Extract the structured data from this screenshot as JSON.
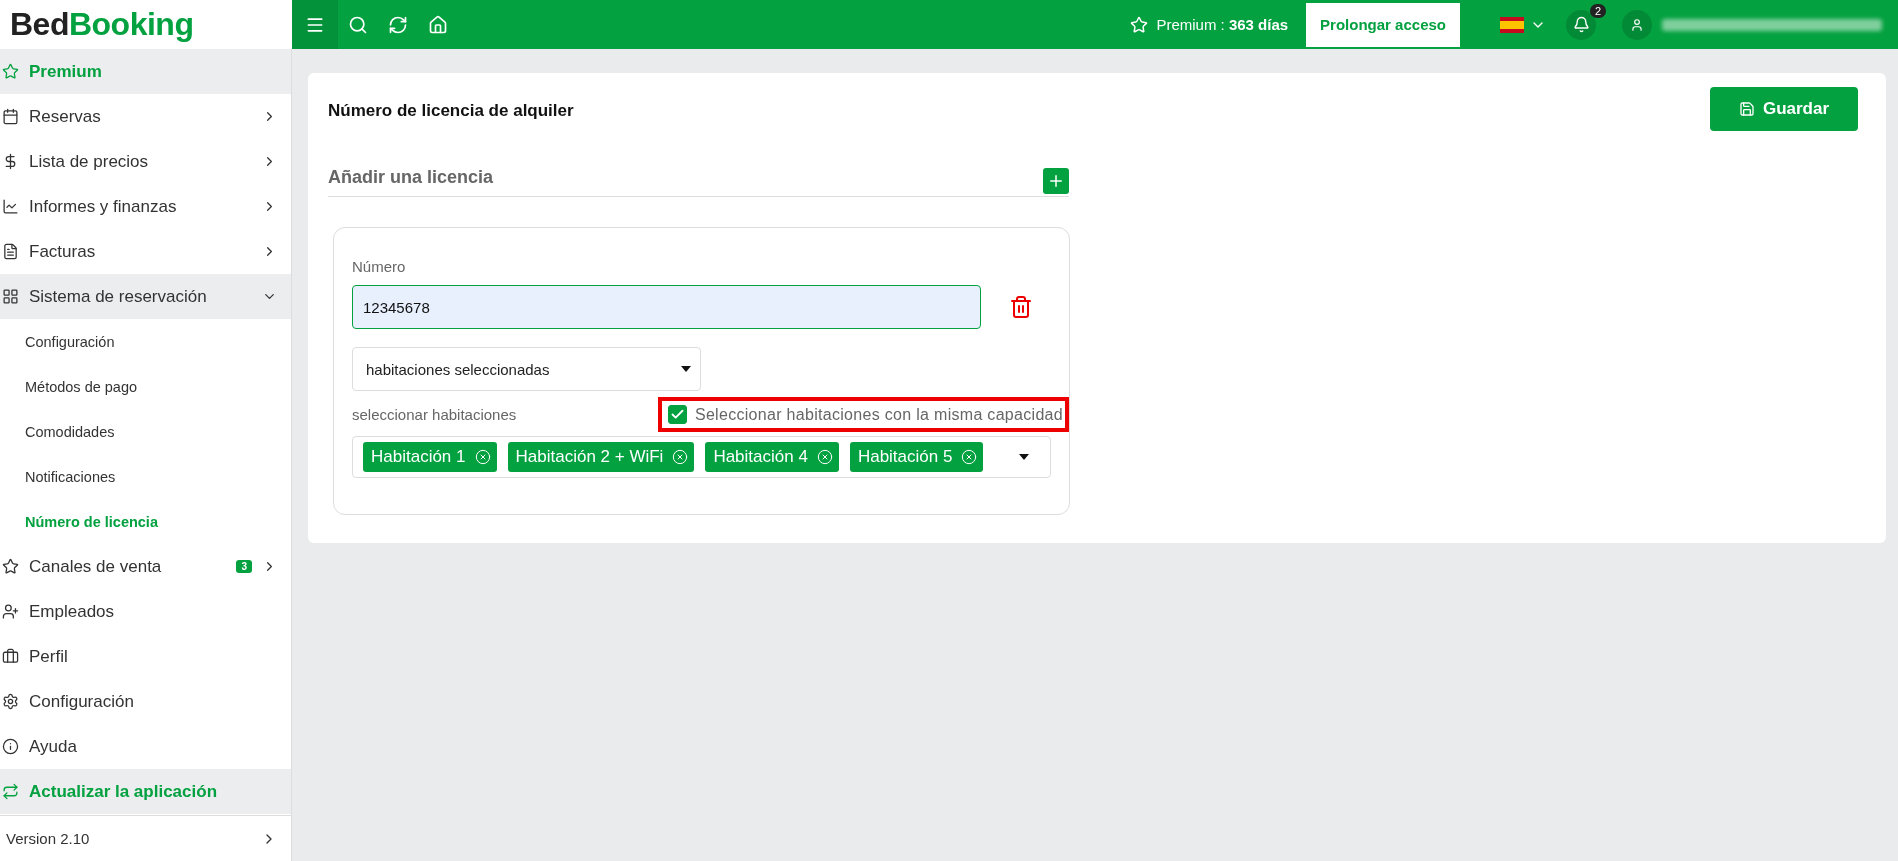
{
  "logo": {
    "dark": "Bed",
    "accent": "Booking"
  },
  "topbar": {
    "premium": "Premium : **363 días**",
    "extend_button": "Prolongar acceso",
    "notifications_count": "2"
  },
  "sidebar": {
    "items": [
      {
        "label": "Premium",
        "kind": "promo"
      },
      {
        "label": "Reservas",
        "kind": "menu",
        "expanded": false
      },
      {
        "label": "Lista de precios",
        "kind": "menu",
        "expanded": false
      },
      {
        "label": "Informes y finanzas",
        "kind": "menu",
        "expanded": false
      },
      {
        "label": "Facturas",
        "kind": "menu",
        "expanded": false
      },
      {
        "label": "Sistema de reservación",
        "kind": "menu",
        "expanded": true,
        "children": [
          {
            "label": "Configuración",
            "selected": false
          },
          {
            "label": "Métodos de pago",
            "selected": false
          },
          {
            "label": "Comodidades",
            "selected": false
          },
          {
            "label": "Notificaciones",
            "selected": false
          },
          {
            "label": "Número de licencia",
            "selected": true
          }
        ]
      },
      {
        "label": "Canales de venta",
        "kind": "menu",
        "expanded": false,
        "badge": "3"
      },
      {
        "label": "Empleados",
        "kind": "link"
      },
      {
        "label": "Perfil",
        "kind": "link"
      },
      {
        "label": "Configuración",
        "kind": "link"
      },
      {
        "label": "Ayuda",
        "kind": "link"
      },
      {
        "label": "Actualizar la aplicación",
        "kind": "promo"
      }
    ],
    "version": "Version 2.10"
  },
  "page": {
    "title": "Número de licencia de alquiler",
    "save_button": "Guardar",
    "add_section": "Añadir una licencia",
    "licenses": [
      {
        "number_label": "Número",
        "number_value": "12345678",
        "scope": "habitaciones seleccionadas",
        "rooms_label": "seleccionar habitaciones",
        "same_capacity": {
          "label": "Seleccionar habitaciones con la misma capacidad",
          "checked": true
        },
        "rooms": [
          "Habitación 1",
          "Habitación 2 + WiFi",
          "Habitación 4",
          "Habitación 5"
        ]
      }
    ]
  }
}
